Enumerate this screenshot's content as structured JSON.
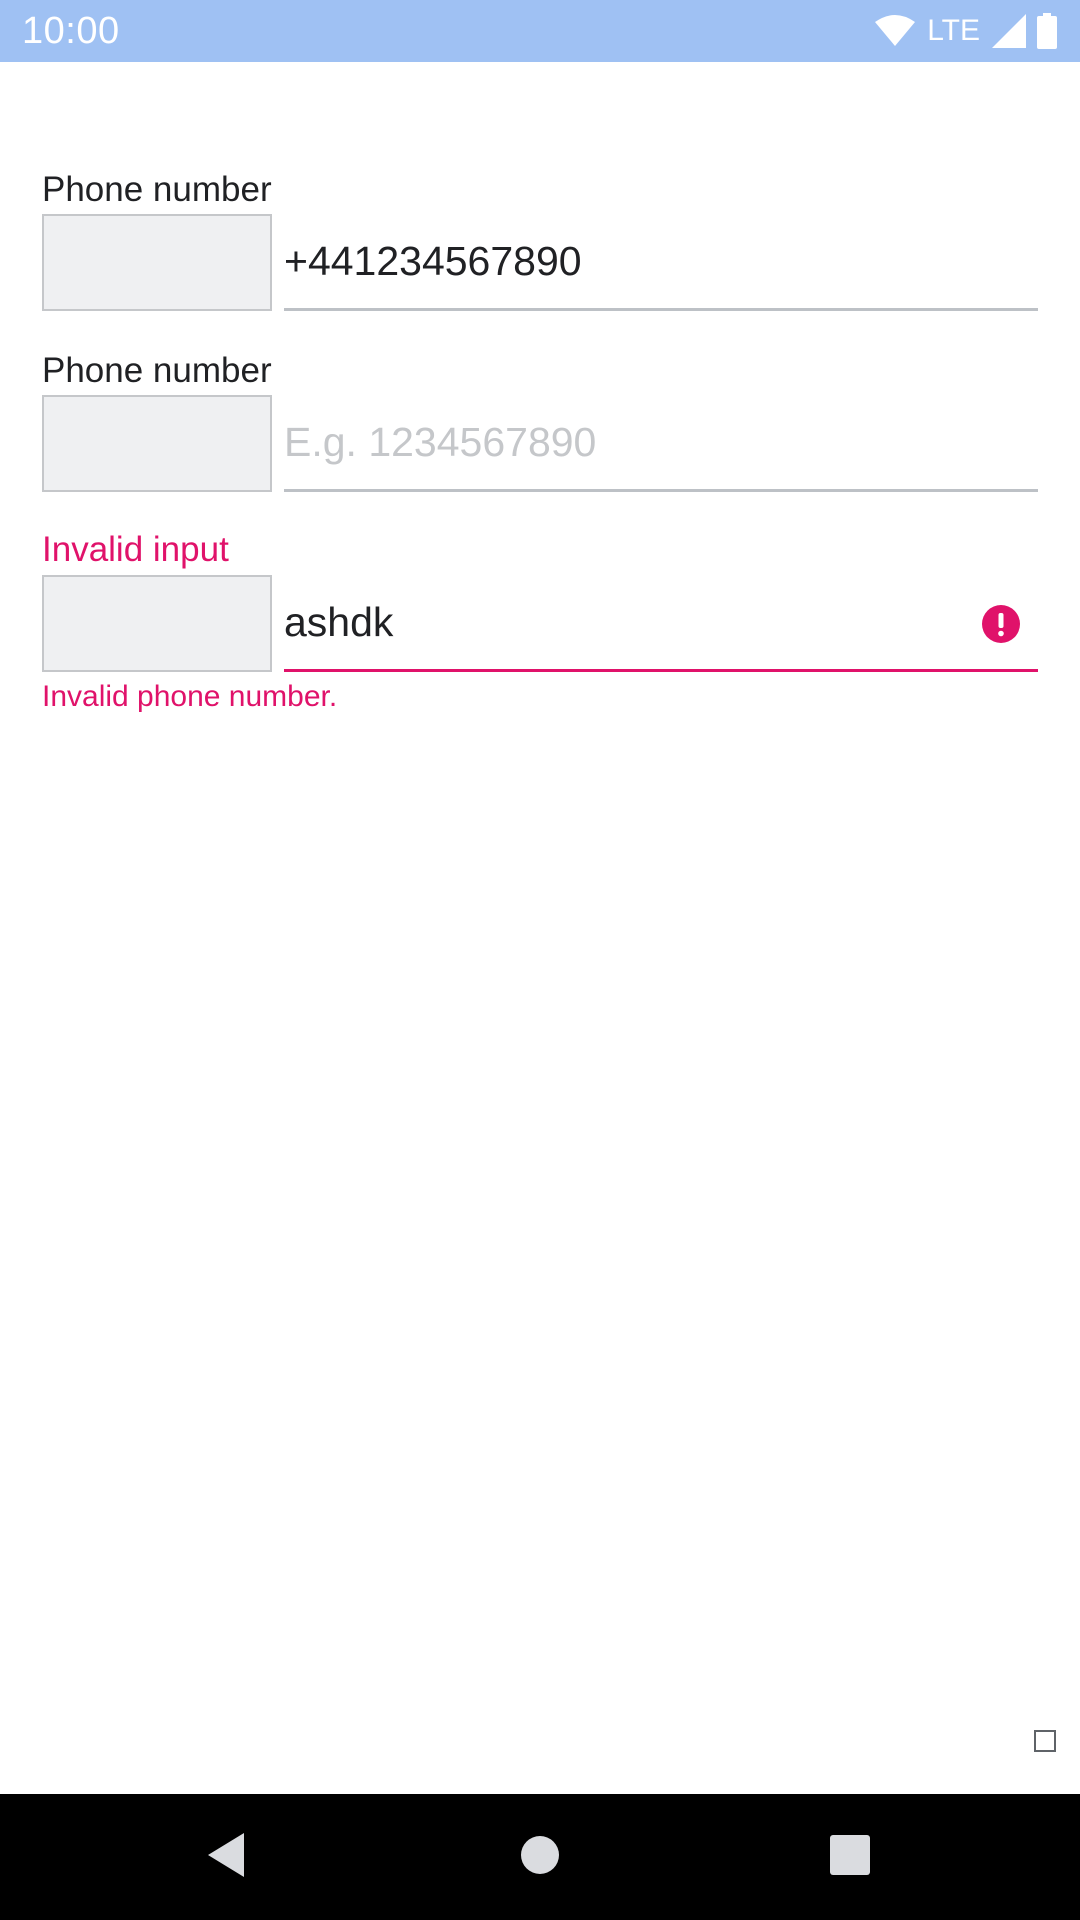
{
  "status_bar": {
    "time": "10:00",
    "network": "LTE",
    "icons": [
      "wifi-icon",
      "cellular-signal-icon",
      "battery-icon"
    ]
  },
  "form": {
    "fields": [
      {
        "label": "Phone number",
        "value": "+441234567890",
        "placeholder": ""
      },
      {
        "label": "Phone number",
        "value": "",
        "placeholder": "E.g. 1234567890"
      },
      {
        "label": "Invalid input",
        "value": "ashdk",
        "placeholder": "",
        "error": "Invalid phone number."
      }
    ]
  },
  "colors": {
    "status_bar": "#9fc1f3",
    "error": "#e0126a",
    "underline": "#bdc1c6",
    "country_box": "#eff0f2"
  },
  "nav_bar": {
    "buttons": [
      "back-icon",
      "home-icon",
      "recents-icon"
    ]
  }
}
